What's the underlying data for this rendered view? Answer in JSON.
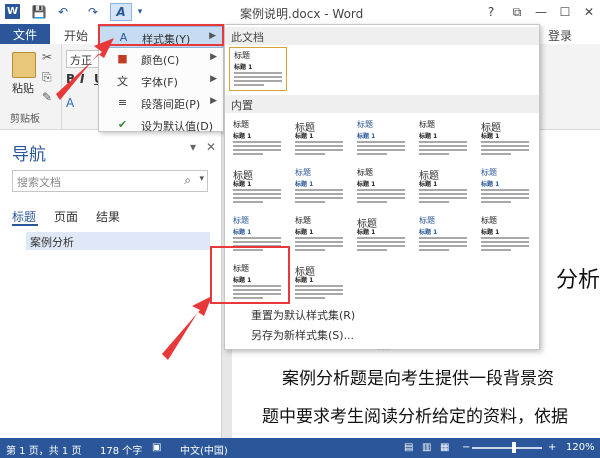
{
  "window": {
    "title": "案例说明.docx - Word",
    "logo_letter": "W",
    "help": "?",
    "restore": "⧉",
    "minimize": "—",
    "maximize": "☐",
    "close": "✕"
  },
  "qat": {
    "save": "💾",
    "undo": "↶",
    "redo": "↷",
    "design": "A",
    "more": "▾"
  },
  "ribbon_tabs": {
    "file": "文件",
    "home": "开始",
    "account": "登录"
  },
  "ribbon": {
    "paste": "粘贴",
    "clipboard_group": "剪贴板",
    "font_name": "方正",
    "bold": "B",
    "italic": "I",
    "underline": "U",
    "font_color": "A"
  },
  "menu": {
    "items": [
      {
        "icon": "A",
        "label": "样式集(Y)",
        "arrow": "▶"
      },
      {
        "icon": "■",
        "label": "颜色(C)",
        "arrow": "▶"
      },
      {
        "icon": "文",
        "label": "字体(F)",
        "arrow": "▶"
      },
      {
        "icon": "≡",
        "label": "段落间距(P)",
        "arrow": "▶"
      },
      {
        "icon": "✔",
        "label": "设为默认值(D)",
        "arrow": ""
      }
    ]
  },
  "gallery": {
    "section_this_doc": "此文档",
    "section_builtin": "内置",
    "thumb_title": "标题",
    "thumb_heading": "标题 1",
    "reset": "重置为默认样式集(R)",
    "save_new": "另存为新样式集(S)...",
    "grip": "....."
  },
  "navigation": {
    "title": "导航",
    "pin": "▾",
    "close": "✕",
    "search_placeholder": "搜索文档",
    "search_icon": "⌕",
    "search_dropdown": "▾",
    "tabs": [
      "标题",
      "页面",
      "结果"
    ],
    "heading_item": "案例分析"
  },
  "document": {
    "heading_fragment": "分析",
    "lines": [
      "案例分析题是向考生提供一段背景资",
      "题中要求考生阅读分析给定的资料，依据"
    ]
  },
  "status": {
    "page": "第 1 页，共 1 页",
    "words": "178 个字",
    "proof_icon": "▣",
    "language": "中文(中国)",
    "view_icons": [
      "▤",
      "▥",
      "▦"
    ],
    "zoom_minus": "−",
    "zoom_plus": "+",
    "zoom": "120%",
    "zoom_level": 0.6
  },
  "colors": {
    "accent": "#2b579a",
    "highlight": "#e8383a"
  }
}
